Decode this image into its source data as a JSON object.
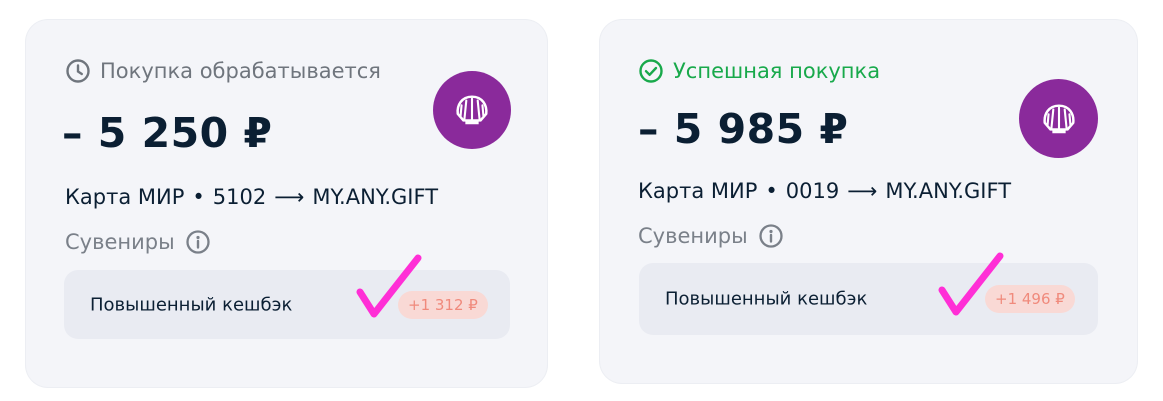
{
  "colors": {
    "card_bg": "#f4f5f9",
    "amount_text": "#0b1f33",
    "pending_status": "#6f757d",
    "success_status": "#18a94b",
    "merchant_logo_bg": "#8a2a9b",
    "cashback_badge_bg": "#f9d9d5",
    "cashback_badge_text": "#f08a7c",
    "annotation_check": "#ff2fd6"
  },
  "cards": [
    {
      "status": {
        "text": "Покупка обрабатывается",
        "icon": "clock-icon",
        "type": "pending"
      },
      "amount": "– 5 250 ₽",
      "merchant_icon": "shell-icon",
      "route": {
        "card": "Карта МИР",
        "separator": "•",
        "last4": "5102",
        "arrow": "⟶",
        "merchant": "MY.ANY.GIFT"
      },
      "category": {
        "text": "Сувениры",
        "icon": "info-icon"
      },
      "cashback": {
        "label": "Повышенный кешбэк",
        "value": "+1 312 ₽"
      }
    },
    {
      "status": {
        "text": "Успешная покупка",
        "icon": "check-circle-icon",
        "type": "success"
      },
      "amount": "– 5 985 ₽",
      "merchant_icon": "shell-icon",
      "route": {
        "card": "Карта МИР",
        "separator": "•",
        "last4": "0019",
        "arrow": "⟶",
        "merchant": "MY.ANY.GIFT"
      },
      "category": {
        "text": "Сувениры",
        "icon": "info-icon"
      },
      "cashback": {
        "label": "Повышенный кешбэк",
        "value": "+1 496 ₽"
      }
    }
  ]
}
